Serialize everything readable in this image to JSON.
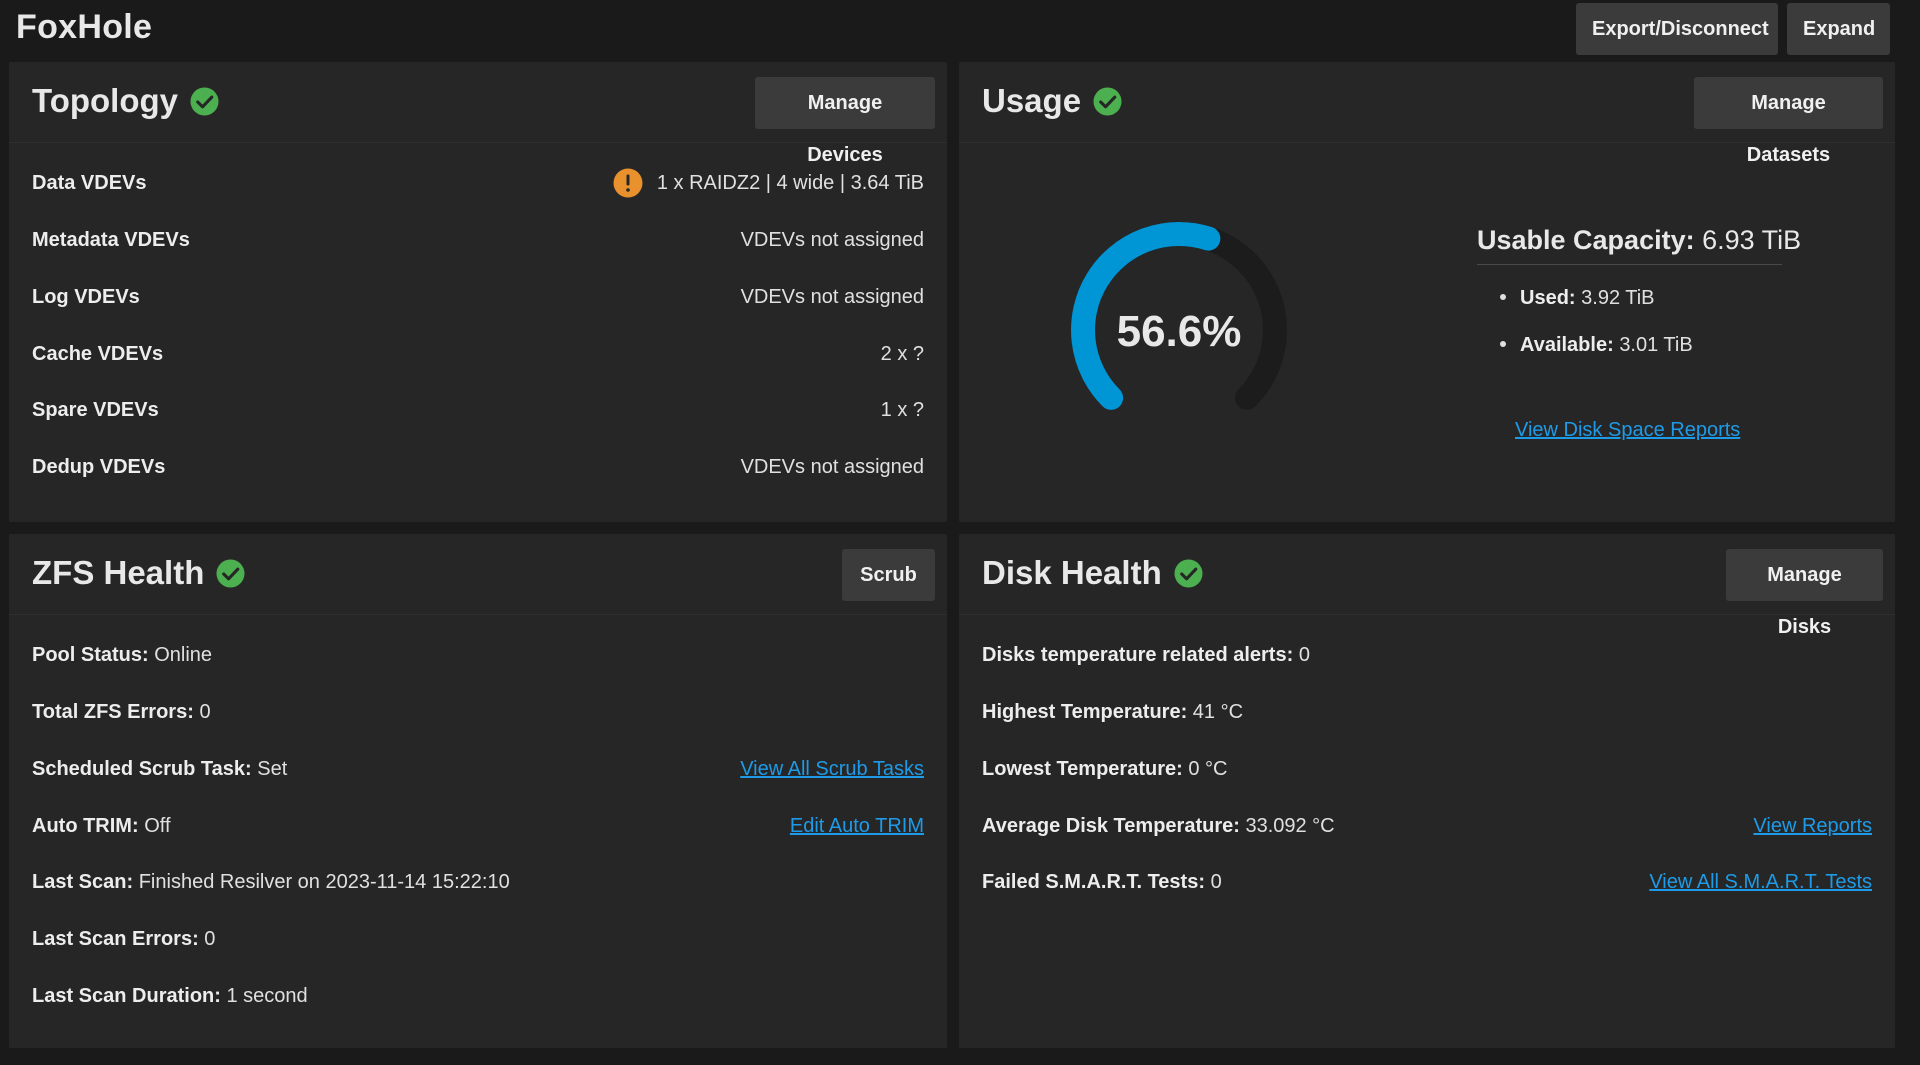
{
  "header": {
    "pool_name": "FoxHole",
    "export_label": "Export/Disconnect",
    "expand_label": "Expand"
  },
  "topology": {
    "title": "Topology",
    "button_label": "Manage Devices",
    "rows": [
      {
        "label": "Data VDEVs",
        "value": "1 x RAIDZ2 | 4 wide | 3.64 TiB",
        "warning": true
      },
      {
        "label": "Metadata VDEVs",
        "value": "VDEVs not assigned"
      },
      {
        "label": "Log VDEVs",
        "value": "VDEVs not assigned"
      },
      {
        "label": "Cache VDEVs",
        "value": "2 x ?"
      },
      {
        "label": "Spare VDEVs",
        "value": "1 x ?"
      },
      {
        "label": "Dedup VDEVs",
        "value": "VDEVs not assigned"
      }
    ]
  },
  "usage": {
    "title": "Usage",
    "button_label": "Manage Datasets",
    "percent_text": "56.6%",
    "percent_value": 56.6,
    "usable_label": "Usable Capacity:",
    "usable_value": "6.93 TiB",
    "used_label": "Used:",
    "used_value": "3.92 TiB",
    "available_label": "Available:",
    "available_value": "3.01 TiB",
    "report_link": "View Disk Space Reports",
    "gauge_color": "#0095d5",
    "gauge_track_color": "#1c1c1c"
  },
  "zfs_health": {
    "title": "ZFS Health",
    "button_label": "Scrub",
    "pool_status_label": "Pool Status:",
    "pool_status_value": "Online",
    "total_errors_label": "Total ZFS Errors:",
    "total_errors_value": "0",
    "scrub_task_label": "Scheduled Scrub Task:",
    "scrub_task_value": "Set",
    "scrub_task_link": "View All Scrub Tasks",
    "auto_trim_label": "Auto TRIM:",
    "auto_trim_value": "Off",
    "auto_trim_link": "Edit Auto TRIM",
    "last_scan_label": "Last Scan:",
    "last_scan_value": "Finished Resilver on 2023-11-14 15:22:10",
    "last_scan_errors_label": "Last Scan Errors:",
    "last_scan_errors_value": "0",
    "last_scan_duration_label": "Last Scan Duration:",
    "last_scan_duration_value": "1 second"
  },
  "disk_health": {
    "title": "Disk Health",
    "button_label": "Manage Disks",
    "temp_alerts_label": "Disks temperature related alerts:",
    "temp_alerts_value": "0",
    "highest_temp_label": "Highest Temperature:",
    "highest_temp_value": "41 °C",
    "lowest_temp_label": "Lowest Temperature:",
    "lowest_temp_value": "0 °C",
    "avg_temp_label": "Average Disk Temperature:",
    "avg_temp_value": "33.092 °C",
    "view_reports_link": "View Reports",
    "failed_smart_label": "Failed S.M.A.R.T. Tests:",
    "failed_smart_value": "0",
    "smart_link": "View All S.M.A.R.T. Tests"
  },
  "colors": {
    "success": "#4caf50",
    "warning": "#e8912d",
    "link": "#1e9be8"
  }
}
